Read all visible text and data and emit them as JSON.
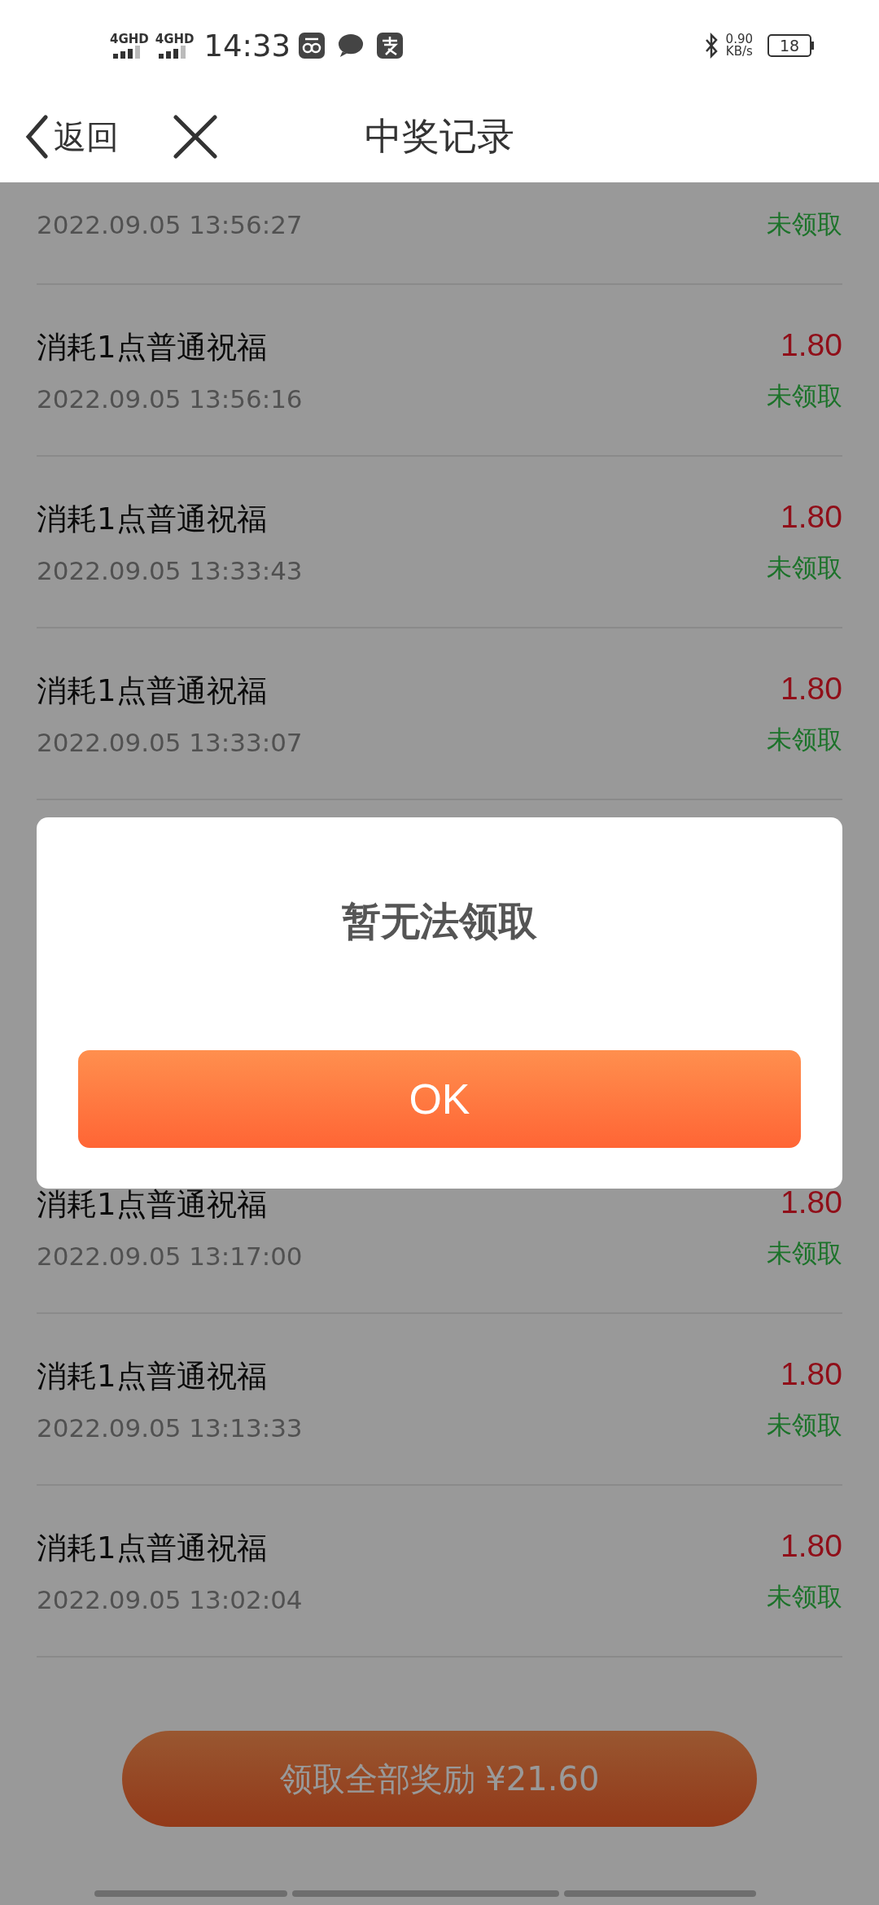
{
  "status_bar": {
    "networks": [
      "4GHD",
      "4GHD"
    ],
    "time": "14:33",
    "speed_value": "0.90",
    "speed_unit": "KB/s",
    "battery": "18"
  },
  "header": {
    "back_label": "返回",
    "title": "中奖记录"
  },
  "records_top": [
    {
      "time": "2022.09.05 13:56:27",
      "status": "未领取"
    },
    {
      "title": "消耗1点普通祝福",
      "time": "2022.09.05 13:56:16",
      "amount": "1.80",
      "status": "未领取"
    },
    {
      "title": "消耗1点普通祝福",
      "time": "2022.09.05 13:33:43",
      "amount": "1.80",
      "status": "未领取"
    },
    {
      "title": "消耗1点普通祝福",
      "time": "2022.09.05 13:33:07",
      "amount": "1.80",
      "status": "未领取"
    }
  ],
  "dialog": {
    "message": "暂无法领取",
    "button": "OK"
  },
  "records_bottom": [
    {
      "title": "消耗1点普通祝福",
      "time": "2022.09.05 13:17:00",
      "amount": "1.80",
      "status": "未领取"
    },
    {
      "title": "消耗1点普通祝福",
      "time": "2022.09.05 13:13:33",
      "amount": "1.80",
      "status": "未领取"
    },
    {
      "title": "消耗1点普通祝福",
      "time": "2022.09.05 13:02:04",
      "amount": "1.80",
      "status": "未领取"
    }
  ],
  "claim_all_button": "领取全部奖励 ¥21.60"
}
